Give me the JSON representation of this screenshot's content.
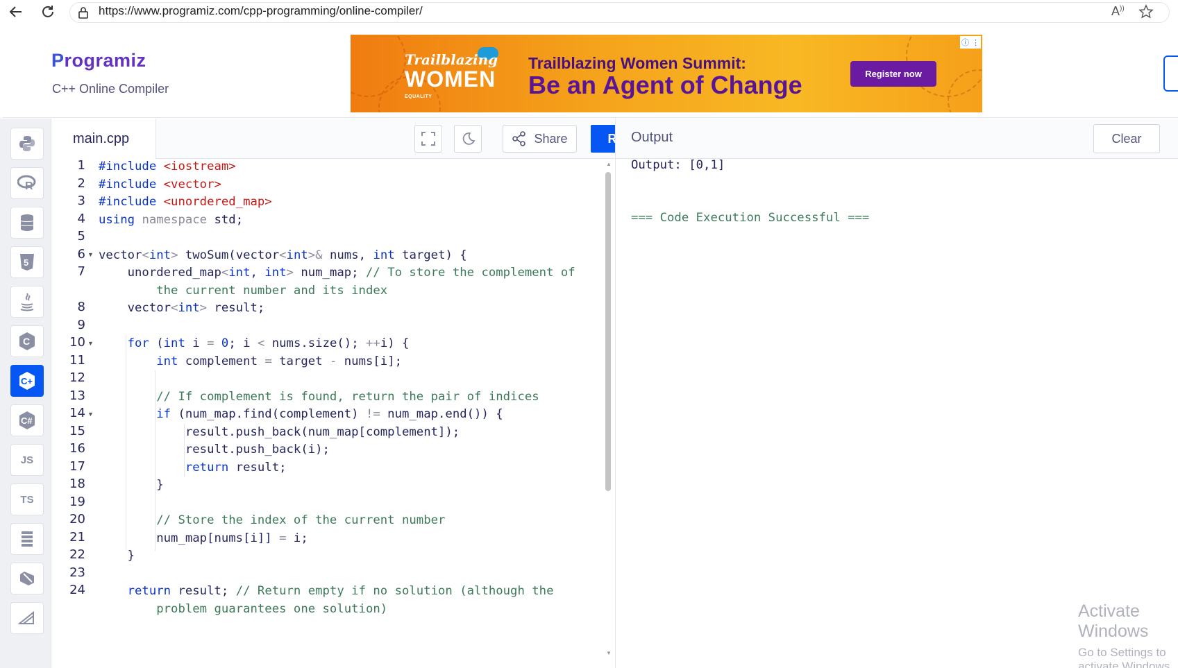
{
  "browser": {
    "url": "https://www.programiz.com/cpp-programming/online-compiler/",
    "icons": [
      "back-arrow-icon",
      "refresh-icon",
      "lock-icon",
      "read-aloud-icon",
      "favorite-star-icon"
    ]
  },
  "header": {
    "logo_text": "rogramiz",
    "logo_letter": "P",
    "subtitle": "C++ Online Compiler"
  },
  "ad": {
    "brand_line1": "Trailblazing",
    "brand_line2": "WOMEN",
    "brand_line3": "EQUALITY",
    "headline1": "Trailblazing Women Summit:",
    "headline2": "Be an Agent of Change",
    "cta": "Register now",
    "colors": {
      "bg": "#f5a41c",
      "cta": "#6a1ba2",
      "text": "#5a1597"
    }
  },
  "sidebar": {
    "languages": [
      {
        "name": "python",
        "label": "🐍",
        "active": false
      },
      {
        "name": "r",
        "label": "R",
        "active": false
      },
      {
        "name": "sql",
        "label": "≡",
        "active": false
      },
      {
        "name": "html",
        "label": "5",
        "active": false
      },
      {
        "name": "java",
        "label": "♨",
        "active": false
      },
      {
        "name": "c",
        "label": "C",
        "active": false
      },
      {
        "name": "cpp",
        "label": "C+",
        "active": true
      },
      {
        "name": "csharp",
        "label": "C#",
        "active": false
      },
      {
        "name": "javascript",
        "label": "JS",
        "active": false
      },
      {
        "name": "typescript",
        "label": "TS",
        "active": false
      },
      {
        "name": "go",
        "label": "≣",
        "active": false
      },
      {
        "name": "swift",
        "label": "◆",
        "active": false
      },
      {
        "name": "rust",
        "label": "◢",
        "active": false
      }
    ]
  },
  "editor": {
    "filename": "main.cpp",
    "share_label": "Share",
    "run_label": "Run",
    "line_numbers": [
      "1",
      "2",
      "3",
      "4",
      "5",
      "6",
      "7",
      "8",
      "9",
      "10",
      "11",
      "12",
      "13",
      "14",
      "15",
      "16",
      "17",
      "18",
      "19",
      "20",
      "21",
      "22",
      "23",
      "24"
    ]
  },
  "output": {
    "title": "Output",
    "clear_label": "Clear",
    "line1": "Output: [0,1]",
    "line2": "=== Code Execution Successful ==="
  },
  "watermark": {
    "line1": "Activate Windows",
    "line2": "Go to Settings to activate Windows."
  },
  "colors": {
    "accent": "#0556f3",
    "keyword": "#0a35c9",
    "string": "#c41a16",
    "comment": "#3d7a5a"
  }
}
